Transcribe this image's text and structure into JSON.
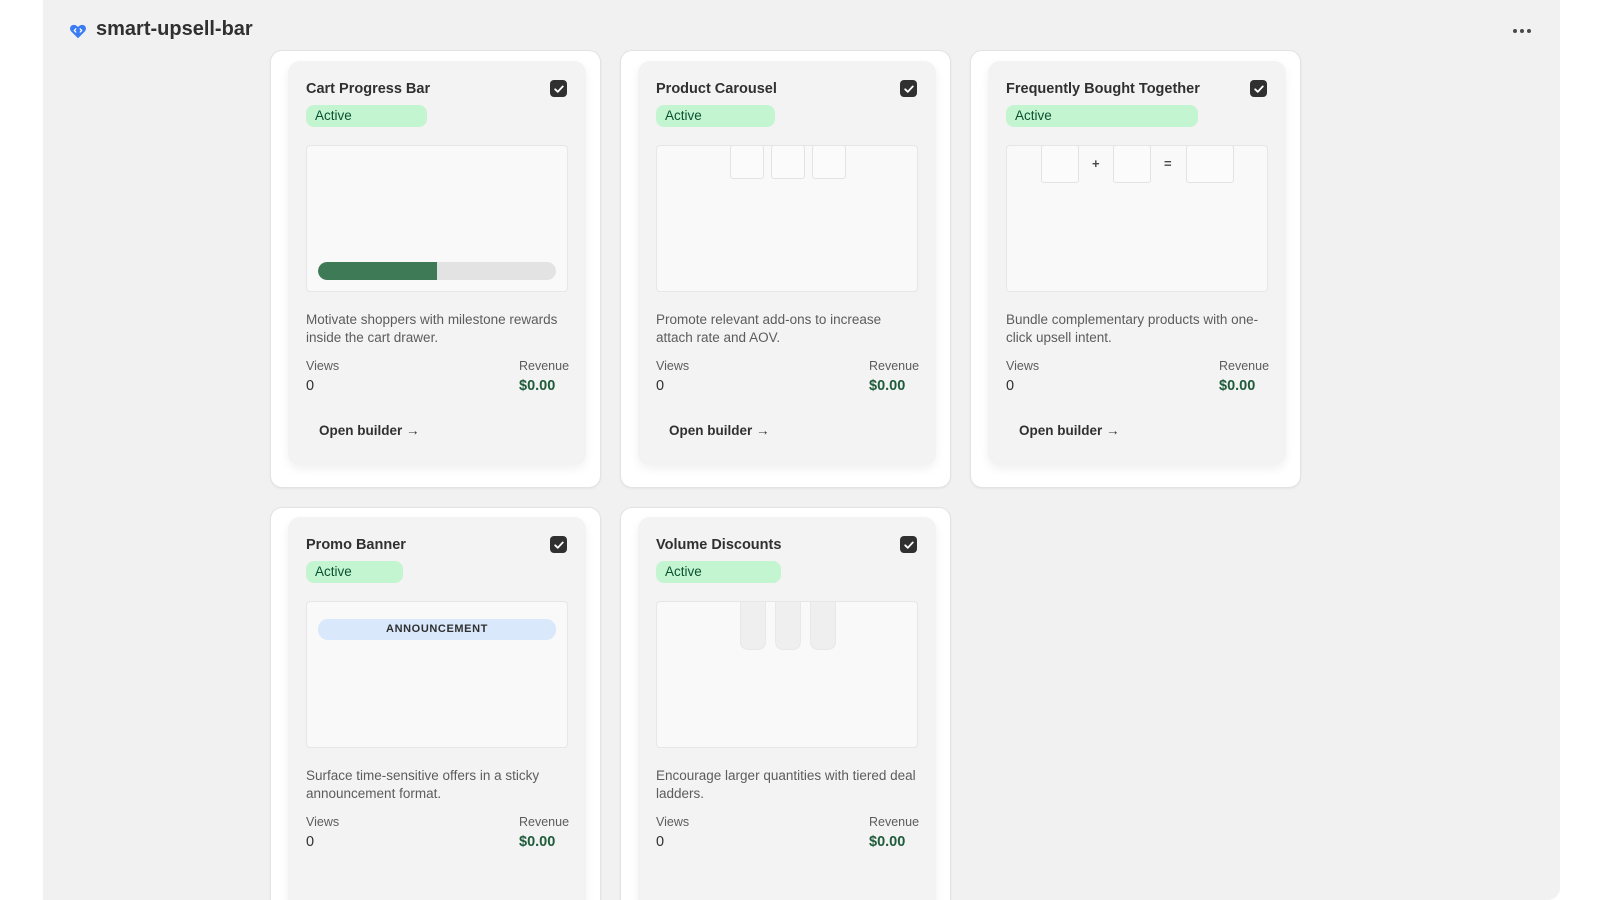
{
  "app": {
    "title": "smart-upsell-bar",
    "icon": "heart-code-icon",
    "accent": "#3b7bf5"
  },
  "colors": {
    "badge_bg": "#c2f5d0",
    "badge_text": "#0c5132",
    "revenue_text": "#1f5c3b",
    "progress_fill": "#3f7a57",
    "announcement_bg": "#d9e8fb"
  },
  "labels": {
    "views": "Views",
    "revenue": "Revenue",
    "open_builder": "Open builder →"
  },
  "cards": [
    {
      "title": "Cart Progress Bar",
      "status": "Active",
      "checked": true,
      "description": "Motivate shoppers with milestone rewards inside the cart drawer.",
      "views": "0",
      "revenue": "$0.00",
      "progress_fraction": 0.5
    },
    {
      "title": "Product Carousel",
      "status": "Active",
      "checked": true,
      "description": "Promote relevant add-ons to increase attach rate and AOV.",
      "views": "0",
      "revenue": "$0.00"
    },
    {
      "title": "Frequently Bought Together",
      "status": "Active",
      "checked": true,
      "description": "Bundle complementary products with one-click upsell intent.",
      "views": "0",
      "revenue": "$0.00",
      "plus": "+",
      "equals": "="
    },
    {
      "title": "Promo Banner",
      "status": "Active",
      "checked": true,
      "description": "Surface time-sensitive offers in a sticky announcement format.",
      "views": "0",
      "revenue": "$0.00",
      "announcement": "ANNOUNCEMENT"
    },
    {
      "title": "Volume Discounts",
      "status": "Active",
      "checked": true,
      "description": "Encourage larger quantities with tiered deal ladders.",
      "views": "0",
      "revenue": "$0.00"
    }
  ]
}
